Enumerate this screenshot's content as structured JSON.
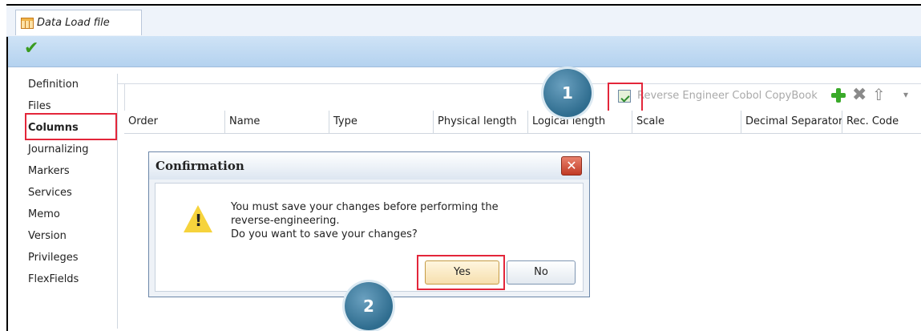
{
  "window": {
    "tab_title": "Data Load file",
    "tab_icon": "grid-file-icon",
    "save_check_icon": "check-icon"
  },
  "sidebar": {
    "items": [
      {
        "label": "Definition"
      },
      {
        "label": "Files"
      },
      {
        "label": "Columns",
        "active": true
      },
      {
        "label": "Journalizing"
      },
      {
        "label": "Markers"
      },
      {
        "label": "Services"
      },
      {
        "label": "Memo"
      },
      {
        "label": "Version"
      },
      {
        "label": "Privileges"
      },
      {
        "label": "FlexFields"
      }
    ]
  },
  "grid_toolbar": {
    "reverse_engineer_label": "Reverse Engineer Cobol CopyBook",
    "icons": [
      "reverse-engineer-icon",
      "add-icon",
      "delete-icon",
      "move-up-icon",
      "more-icon"
    ]
  },
  "columns": {
    "headers": [
      "Order",
      "Name",
      "Type",
      "Physical length",
      "Logical length",
      "Scale",
      "Decimal Separator",
      "Rec. Code"
    ]
  },
  "callouts": {
    "step1": "1",
    "step2": "2"
  },
  "dialog": {
    "title": "Confirmation",
    "message_lines": [
      "You must save your changes before performing the",
      "reverse-engineering.",
      "Do you want to save your changes?"
    ],
    "yes_label": "Yes",
    "no_label": "No",
    "close_label": "✕"
  },
  "colors": {
    "highlight": "#e3263a",
    "callout": "#2f6d8f",
    "toolbar": "#b4d2ef"
  }
}
